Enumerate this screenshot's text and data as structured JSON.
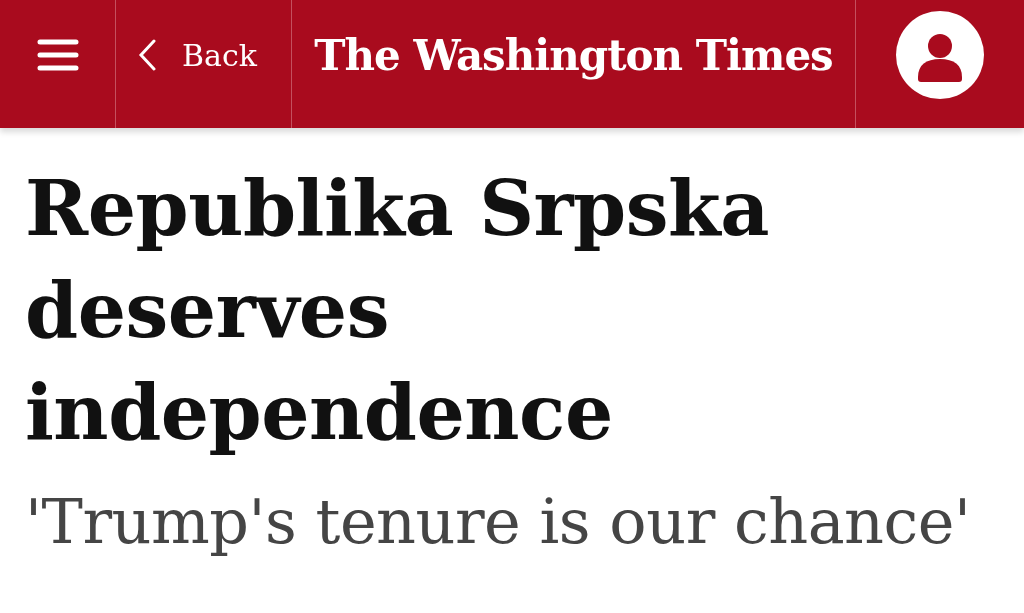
{
  "header": {
    "back_label": "Back",
    "logo": "The Washington Times"
  },
  "article": {
    "headline": "Republika Srpska deserves independence",
    "subheadline": "'Trump's tenure is our chance'"
  }
}
